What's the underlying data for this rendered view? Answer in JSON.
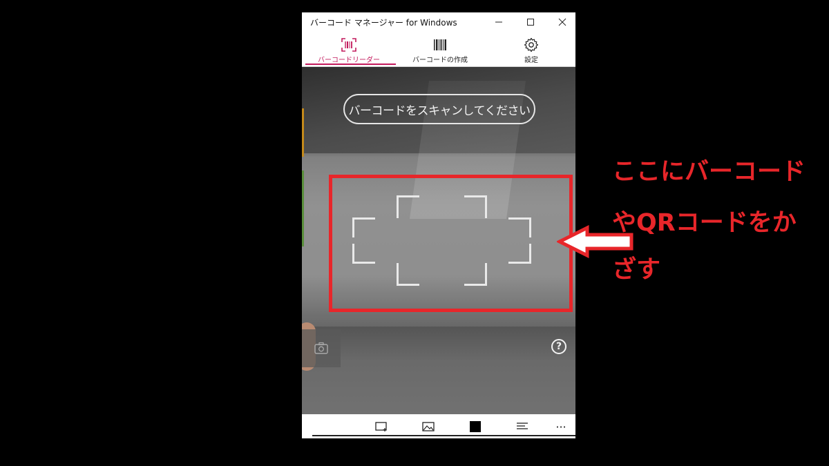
{
  "window": {
    "title": "バーコード マネージャー for Windows"
  },
  "nav": {
    "tabs": [
      {
        "label": "バーコードリーダー",
        "icon": "scan-barcode-icon",
        "active": true
      },
      {
        "label": "バーコードの作成",
        "icon": "barcode-icon",
        "active": false
      },
      {
        "label": "設定",
        "icon": "gear-icon",
        "active": false
      }
    ]
  },
  "camera": {
    "prompt": "バーコードをスキャンしてください",
    "help_glyph": "?"
  },
  "annotation": {
    "lines": [
      "ここにバーコード",
      "やQRコードをか",
      "ざす"
    ],
    "color": "#e8262a"
  },
  "colors": {
    "accent": "#c2185b"
  },
  "command_bar": {
    "more_glyph": "···"
  }
}
